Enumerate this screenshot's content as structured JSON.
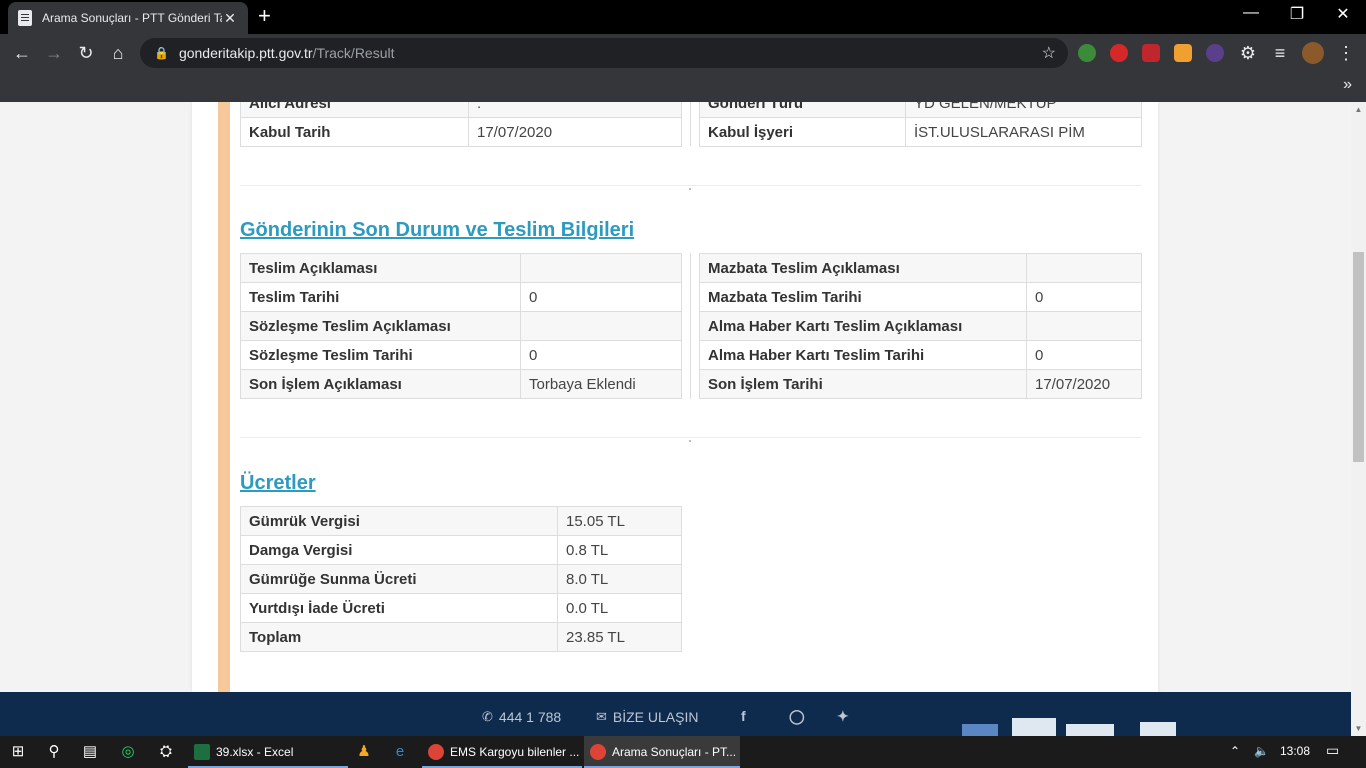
{
  "browser": {
    "tab_title": "Arama Sonuçları - PTT Gönderi Ta",
    "url_host": "gonderitakip.ptt.gov.tr",
    "url_path": "/Track/Result",
    "new_tab_icon": "plus-icon",
    "window_controls": [
      "minimize",
      "restore",
      "close"
    ]
  },
  "top_partial": {
    "rows": [
      {
        "left_key": "Kabul Tarih",
        "left_value": "17/07/2020",
        "right_key": "Kabul İşyeri",
        "right_value": "İST.ULUSLARARASI PİM"
      }
    ],
    "cut_row": {
      "left_key": "Alıcı Adresi",
      "left_value": ":",
      "right_key": "Gönderi Türü",
      "right_value": "YD GELEN/MEKTUP"
    }
  },
  "status_section": {
    "title": "Gönderinin Son Durum ve Teslim Bilgileri",
    "left_rows": [
      {
        "key": "Teslim Açıklaması",
        "value": ""
      },
      {
        "key": "Teslim Tarihi",
        "value": "0"
      },
      {
        "key": "Sözleşme Teslim Açıklaması",
        "value": ""
      },
      {
        "key": "Sözleşme Teslim Tarihi",
        "value": "0"
      },
      {
        "key": "Son İşlem Açıklaması",
        "value": "Torbaya Eklendi"
      }
    ],
    "right_rows": [
      {
        "key": "Mazbata Teslim Açıklaması",
        "value": ""
      },
      {
        "key": "Mazbata Teslim Tarihi",
        "value": "0"
      },
      {
        "key": "Alma Haber Kartı Teslim Açıklaması",
        "value": ""
      },
      {
        "key": "Alma Haber Kartı Teslim Tarihi",
        "value": "0"
      },
      {
        "key": "Son İşlem Tarihi",
        "value": "17/07/2020"
      }
    ]
  },
  "fees_section": {
    "title": "Ücretler",
    "rows": [
      {
        "key": "Gümrük Vergisi",
        "value": "15.05 TL"
      },
      {
        "key": "Damga Vergisi",
        "value": "0.8 TL"
      },
      {
        "key": "Gümrüğe Sunma Ücreti",
        "value": "8.0 TL"
      },
      {
        "key": "Yurtdışı İade Ücreti",
        "value": "0.0 TL"
      },
      {
        "key": "Toplam",
        "value": "23.85 TL"
      }
    ]
  },
  "footer": {
    "phone": "444 1 788",
    "contact": "BİZE ULAŞIN",
    "social": [
      "facebook-icon",
      "instagram-icon",
      "twitter-icon"
    ]
  },
  "taskbar": {
    "apps": [
      {
        "label": "39.xlsx - Excel"
      },
      {
        "label": "EMS Kargoyu bilenler ..."
      },
      {
        "label": "Arama Sonuçları - PT..."
      }
    ],
    "clock": "13:08"
  }
}
